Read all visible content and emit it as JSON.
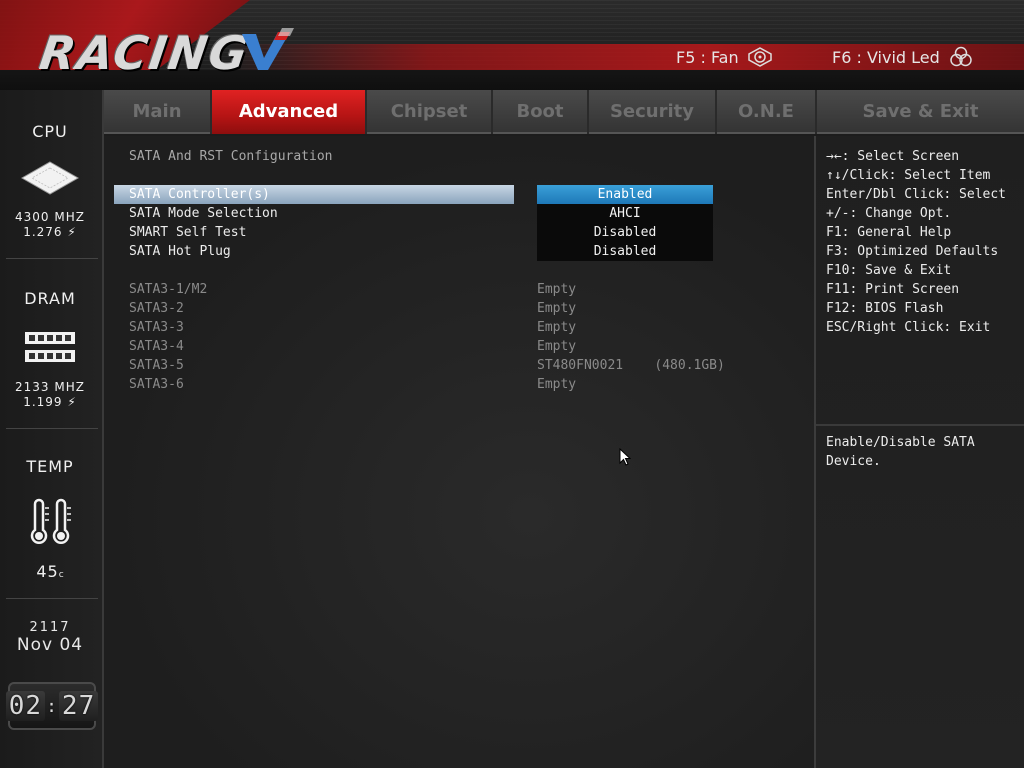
{
  "header": {
    "logo_text": "RACING",
    "hotkeys": [
      {
        "label": "F5 : Fan",
        "icon": "fan-icon"
      },
      {
        "label": "F6 : Vivid Led",
        "icon": "led-icon"
      }
    ]
  },
  "sidebar": {
    "cpu": {
      "title": "CPU",
      "freq": "4300 MHZ",
      "volt": "1.276"
    },
    "dram": {
      "title": "DRAM",
      "freq": "2133 MHZ",
      "volt": "1.199"
    },
    "temp": {
      "title": "TEMP",
      "value": "45",
      "unit": "c"
    },
    "date": {
      "year": "2117",
      "day": "Nov 04"
    },
    "clock": {
      "hours": "02",
      "minutes": "27"
    }
  },
  "tabs": [
    {
      "label": "Main"
    },
    {
      "label": "Advanced",
      "active": true
    },
    {
      "label": "Chipset"
    },
    {
      "label": "Boot"
    },
    {
      "label": "Security"
    },
    {
      "label": "O.N.E"
    },
    {
      "label": "Save & Exit"
    }
  ],
  "main": {
    "section_title": "SATA And RST Configuration",
    "options": [
      {
        "label": "SATA Controller(s)",
        "value": "Enabled",
        "selected": true
      },
      {
        "label": "SATA Mode Selection",
        "value": "AHCI"
      },
      {
        "label": "SMART Self Test",
        "value": "Disabled"
      },
      {
        "label": "SATA Hot Plug",
        "value": "Disabled"
      }
    ],
    "ports": [
      {
        "label": "SATA3-1/M2",
        "value": "Empty"
      },
      {
        "label": "SATA3-2",
        "value": "Empty"
      },
      {
        "label": "SATA3-3",
        "value": "Empty"
      },
      {
        "label": "SATA3-4",
        "value": "Empty"
      },
      {
        "label": "SATA3-5",
        "value": "ST480FN0021    (480.1GB)"
      },
      {
        "label": "SATA3-6",
        "value": "Empty"
      }
    ]
  },
  "help": {
    "keys": [
      "→←: Select Screen",
      "↑↓/Click: Select Item",
      "Enter/Dbl Click: Select",
      "+/-: Change Opt.",
      "F1: General Help",
      "F3: Optimized Defaults",
      "F10: Save & Exit",
      "F11: Print Screen",
      "F12: BIOS Flash",
      "ESC/Right Click: Exit"
    ],
    "description": "Enable/Disable SATA Device."
  },
  "colors": {
    "accent_red": "#d81c1c",
    "selected_value": "#2a8cc8",
    "selected_row": "#a9bccf"
  }
}
